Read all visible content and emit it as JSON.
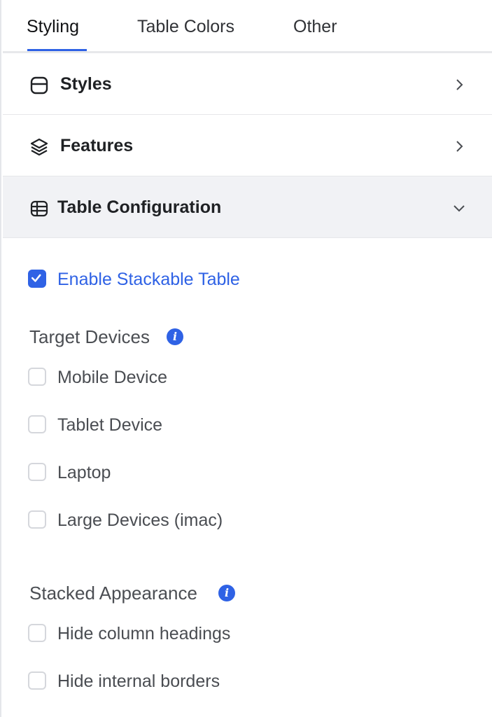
{
  "tabs": [
    {
      "label": "Styling",
      "active": true
    },
    {
      "label": "Table Colors",
      "active": false
    },
    {
      "label": "Other",
      "active": false
    }
  ],
  "panels": [
    {
      "label": "Styles",
      "icon": "rounded-rect-icon",
      "state": "collapsed"
    },
    {
      "label": "Features",
      "icon": "layers-icon",
      "state": "collapsed"
    },
    {
      "label": "Table Configuration",
      "icon": "table-grid-icon",
      "state": "expanded"
    }
  ],
  "stackable": {
    "label": "Enable Stackable Table",
    "checked": true
  },
  "target_devices": {
    "title": "Target Devices",
    "info_glyph": "i",
    "options": [
      {
        "label": "Mobile Device",
        "checked": false
      },
      {
        "label": "Tablet Device",
        "checked": false
      },
      {
        "label": "Laptop",
        "checked": false
      },
      {
        "label": "Large Devices (imac)",
        "checked": false
      }
    ]
  },
  "stacked_appearance": {
    "title": "Stacked Appearance",
    "info_glyph": "i",
    "options": [
      {
        "label": "Hide column headings",
        "checked": false
      },
      {
        "label": "Hide internal borders",
        "checked": false
      }
    ]
  },
  "colors": {
    "accent": "#2f62e5",
    "border": "#e6e7ea",
    "open_panel_bg": "#f1f2f5"
  }
}
